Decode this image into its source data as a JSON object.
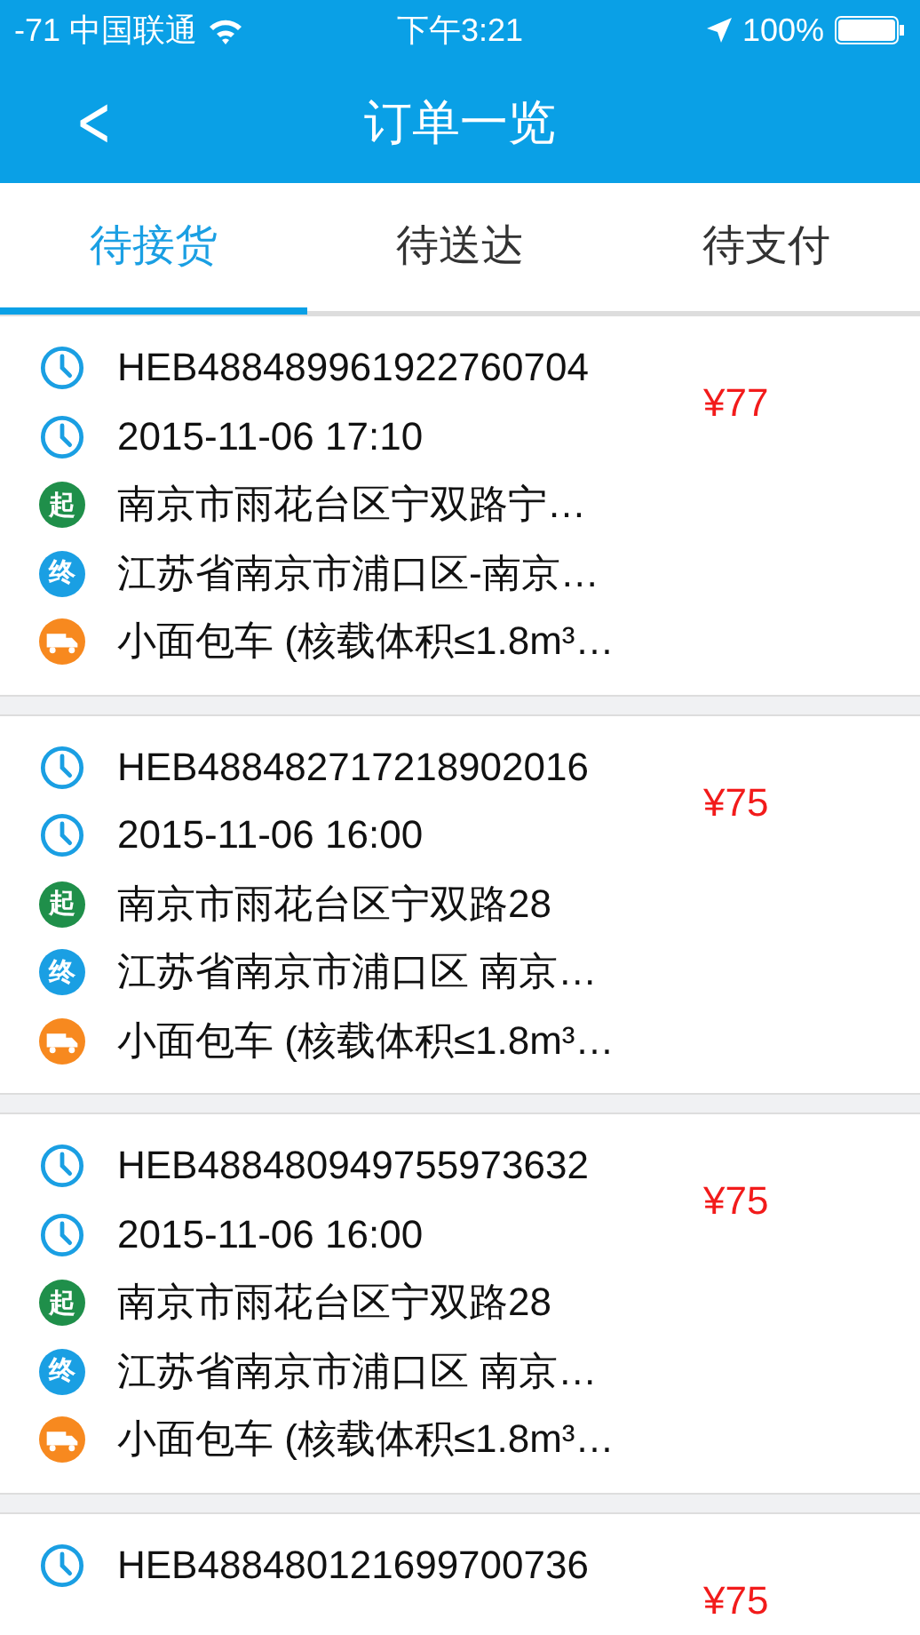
{
  "status_bar": {
    "carrier": "-71 中国联通",
    "time": "下午3:21",
    "battery": "100%"
  },
  "nav": {
    "back": "<",
    "title": "订单一览"
  },
  "tabs": [
    {
      "label": "待接货",
      "selected": true
    },
    {
      "label": "待送达",
      "selected": false
    },
    {
      "label": "待支付",
      "selected": false
    }
  ],
  "orders": [
    {
      "price": "¥77",
      "rows": [
        {
          "kind": "order",
          "text": "HEB488489961922760704"
        },
        {
          "kind": "time",
          "text": "2015-11-06 17:10"
        },
        {
          "kind": "start",
          "badge": "起",
          "text": "南京市雨花台区宁双路宁…"
        },
        {
          "kind": "end",
          "badge": "终",
          "text": "江苏省南京市浦口区-南京…"
        },
        {
          "kind": "vehicle",
          "text": "小面包车 (核载体积≤1.8m³…"
        }
      ]
    },
    {
      "price": "¥75",
      "rows": [
        {
          "kind": "order",
          "text": "HEB488482717218902016"
        },
        {
          "kind": "time",
          "text": "2015-11-06 16:00"
        },
        {
          "kind": "start",
          "badge": "起",
          "text": "南京市雨花台区宁双路28"
        },
        {
          "kind": "end",
          "badge": "终",
          "text": "江苏省南京市浦口区 南京…"
        },
        {
          "kind": "vehicle",
          "text": "小面包车 (核载体积≤1.8m³…"
        }
      ]
    },
    {
      "price": "¥75",
      "rows": [
        {
          "kind": "order",
          "text": "HEB488480949755973632"
        },
        {
          "kind": "time",
          "text": "2015-11-06 16:00"
        },
        {
          "kind": "start",
          "badge": "起",
          "text": "南京市雨花台区宁双路28"
        },
        {
          "kind": "end",
          "badge": "终",
          "text": "江苏省南京市浦口区 南京…"
        },
        {
          "kind": "vehicle",
          "text": "小面包车 (核载体积≤1.8m³…"
        }
      ]
    },
    {
      "price": "¥75",
      "rows": [
        {
          "kind": "order",
          "text": "HEB488480121699700736"
        }
      ]
    }
  ]
}
